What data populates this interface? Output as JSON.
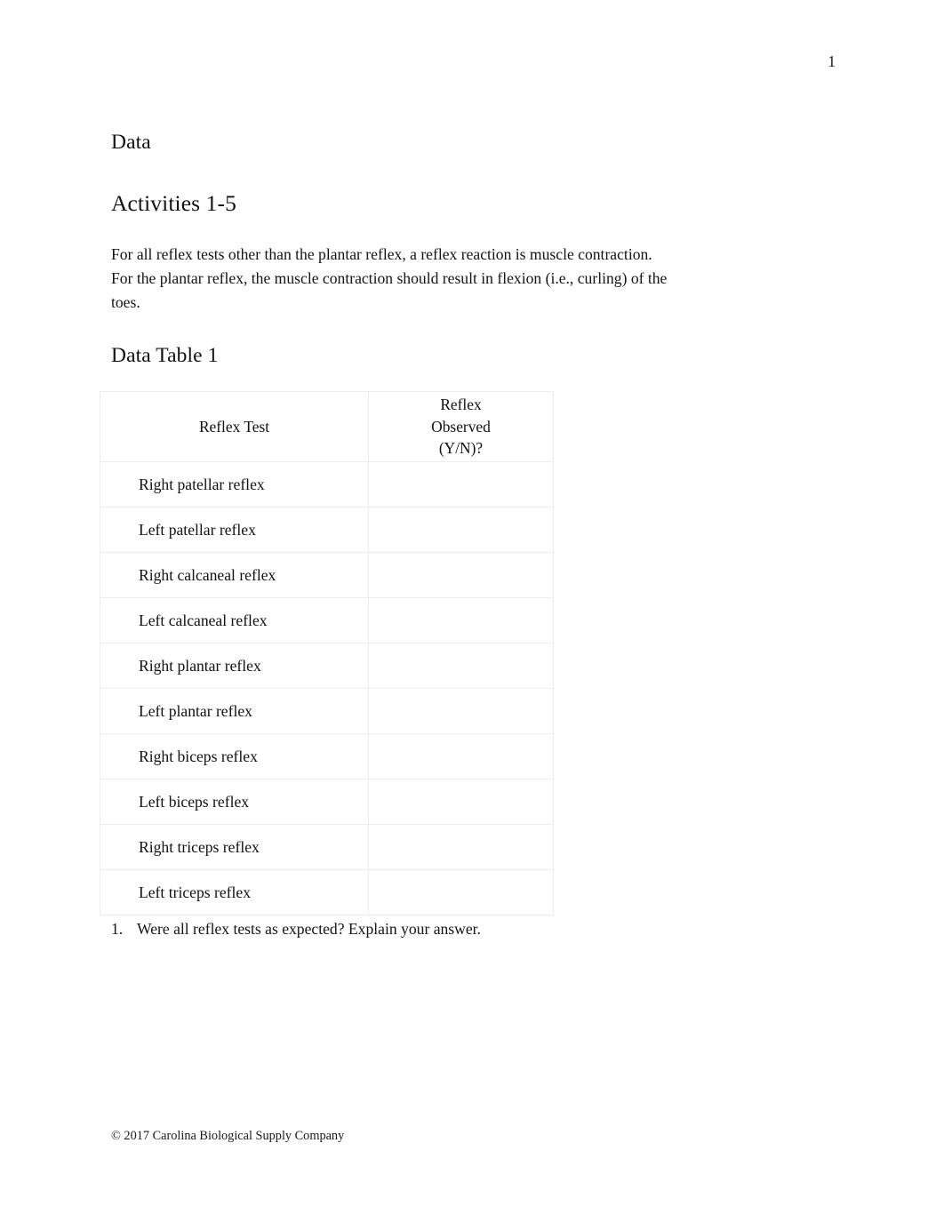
{
  "document": {
    "page_number": "1",
    "headings": {
      "data": "Data",
      "activities": "Activities 1-5",
      "data_table": "Data Table 1"
    },
    "intro_paragraph": "For all reflex tests other than the plantar reflex, a reflex reaction is muscle contraction. For the plantar reflex, the muscle contraction should result in flexion (i.e., curling) of the toes.",
    "table": {
      "columns": [
        "Reflex Test",
        "Reflex Observed (Y/N)?"
      ],
      "column_header_lines": {
        "reflex_test": "Reflex Test",
        "reflex_observed_line1": "Reflex",
        "reflex_observed_line2": "Observed",
        "reflex_observed_line3": "(Y/N)?"
      },
      "rows": [
        {
          "test": "Right patellar reflex",
          "observed": ""
        },
        {
          "test": "Left patellar reflex",
          "observed": ""
        },
        {
          "test": "Right calcaneal reflex",
          "observed": ""
        },
        {
          "test": "Left calcaneal reflex",
          "observed": ""
        },
        {
          "test": "Right plantar reflex",
          "observed": ""
        },
        {
          "test": "Left plantar reflex",
          "observed": ""
        },
        {
          "test": "Right biceps reflex",
          "observed": ""
        },
        {
          "test": "Left biceps reflex",
          "observed": ""
        },
        {
          "test": "Right triceps reflex",
          "observed": ""
        },
        {
          "test": "Left triceps reflex",
          "observed": ""
        }
      ]
    },
    "questions": [
      {
        "number": "1.",
        "text": "Were all reflex tests as expected? Explain your answer."
      }
    ],
    "footer": "© 2017 Carolina Biological Supply Company",
    "colors": {
      "page_background": "#ffffff",
      "text": "#111111",
      "table_border": "#ededed"
    }
  }
}
